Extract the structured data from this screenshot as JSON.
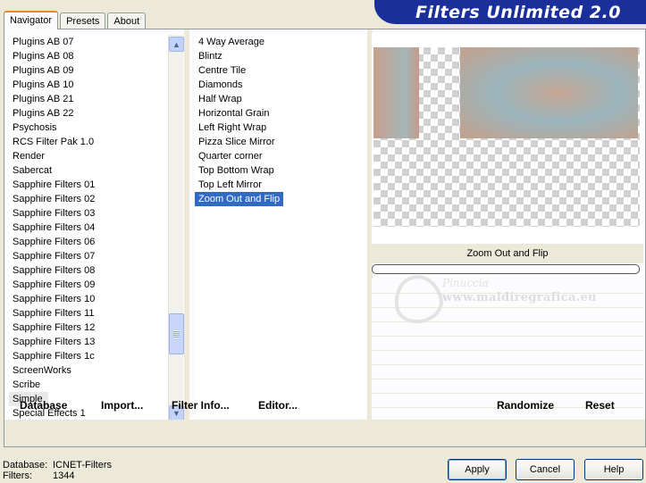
{
  "tabs": [
    {
      "label": "Navigator",
      "active": true
    },
    {
      "label": "Presets",
      "active": false
    },
    {
      "label": "About",
      "active": false
    }
  ],
  "banner": {
    "title": "Filters Unlimited 2.0"
  },
  "categories": [
    "Plugins AB 07",
    "Plugins AB 08",
    "Plugins AB 09",
    "Plugins AB 10",
    "Plugins AB 21",
    "Plugins AB 22",
    "Psychosis",
    "RCS Filter Pak 1.0",
    "Render",
    "Sabercat",
    "Sapphire Filters 01",
    "Sapphire Filters 02",
    "Sapphire Filters 03",
    "Sapphire Filters 04",
    "Sapphire Filters 06",
    "Sapphire Filters 07",
    "Sapphire Filters 08",
    "Sapphire Filters 09",
    "Sapphire Filters 10",
    "Sapphire Filters 11",
    "Sapphire Filters 12",
    "Sapphire Filters 13",
    "Sapphire Filters 1c",
    "ScreenWorks",
    "Scribe",
    "Simple",
    "Special Effects 1"
  ],
  "selected_category": "Simple",
  "filters": [
    "4 Way Average",
    "Blintz",
    "Centre Tile",
    "Diamonds",
    "Half Wrap",
    "Horizontal Grain",
    "Left Right Wrap",
    "Pizza Slice Mirror",
    "Quarter corner",
    "Top Bottom Wrap",
    "Top Left Mirror",
    "Zoom Out and Flip"
  ],
  "selected_filter": "Zoom Out and Flip",
  "preview": {
    "filter_name": "Zoom Out and Flip"
  },
  "watermark": {
    "name": "Pinuccia",
    "url": "www.maldiregrafica.eu"
  },
  "actions": {
    "database": "Database",
    "import": "Import...",
    "filter_info": "Filter Info...",
    "editor": "Editor...",
    "randomize": "Randomize",
    "reset": "Reset"
  },
  "footer": {
    "database_label": "Database:",
    "database_value": "ICNET-Filters",
    "filters_label": "Filters:",
    "filters_value": "1344"
  },
  "buttons": {
    "apply": "Apply",
    "cancel": "Cancel",
    "help": "Help"
  },
  "colors": {
    "banner": "#1A2F9A",
    "selection": "#316AC5",
    "dialog_bg": "#ECE9D8"
  }
}
